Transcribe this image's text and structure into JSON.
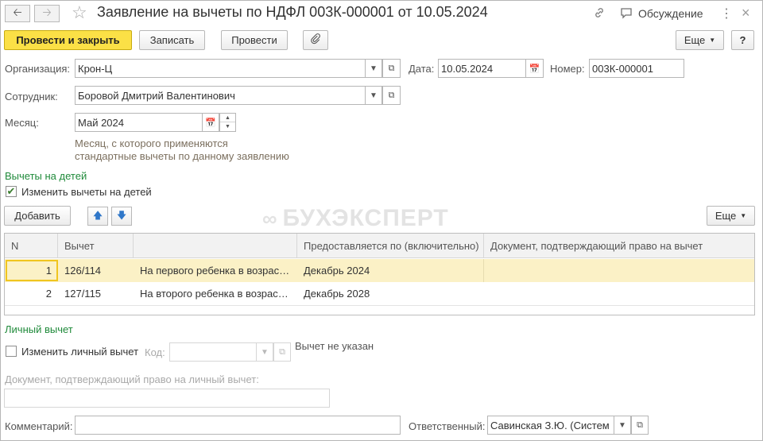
{
  "header": {
    "title": "Заявление на вычеты по НДФЛ 003К-000001 от 10.05.2024",
    "discussion_label": "Обсуждение"
  },
  "toolbar": {
    "post_close_label": "Провести и закрыть",
    "save_label": "Записать",
    "post_label": "Провести",
    "more_label": "Еще",
    "help_label": "?"
  },
  "form": {
    "org_label": "Организация:",
    "org_value": "Крон-Ц",
    "date_label": "Дата:",
    "date_value": "10.05.2024",
    "number_label": "Номер:",
    "number_value": "003К-000001",
    "employee_label": "Сотрудник:",
    "employee_value": "Боровой Дмитрий Валентинович",
    "month_label": "Месяц:",
    "month_value": "Май 2024",
    "month_hint_line1": "Месяц, с которого применяются",
    "month_hint_line2": "стандартные вычеты по данному заявлению"
  },
  "children": {
    "section_title": "Вычеты на детей",
    "change_checkbox_label": "Изменить вычеты на детей",
    "change_checked": true,
    "add_label": "Добавить",
    "more_label": "Еще"
  },
  "watermark": "БУХЭКСПЕРТ",
  "table": {
    "columns": [
      "N",
      "Вычет",
      "",
      "Предоставляется по (включительно)",
      "Документ, подтверждающий право на вычет"
    ],
    "rows": [
      {
        "n": "1",
        "code": "126/114",
        "desc": "На первого ребенка в возрас…",
        "until": "Декабрь 2024",
        "doc": ""
      },
      {
        "n": "2",
        "code": "127/115",
        "desc": "На второго ребенка в возрас…",
        "until": "Декабрь 2028",
        "doc": ""
      }
    ]
  },
  "personal": {
    "section_title": "Личный вычет",
    "change_checkbox_label": "Изменить личный вычет",
    "change_checked": false,
    "code_label": "Код:",
    "code_value": "",
    "not_specified": "Вычет не указан",
    "doc_label": "Документ, подтверждающий право на личный вычет:",
    "doc_value": ""
  },
  "footer": {
    "comment_label": "Комментарий:",
    "comment_value": "",
    "responsible_label": "Ответственный:",
    "responsible_value": "Савинская З.Ю. (Систем"
  }
}
